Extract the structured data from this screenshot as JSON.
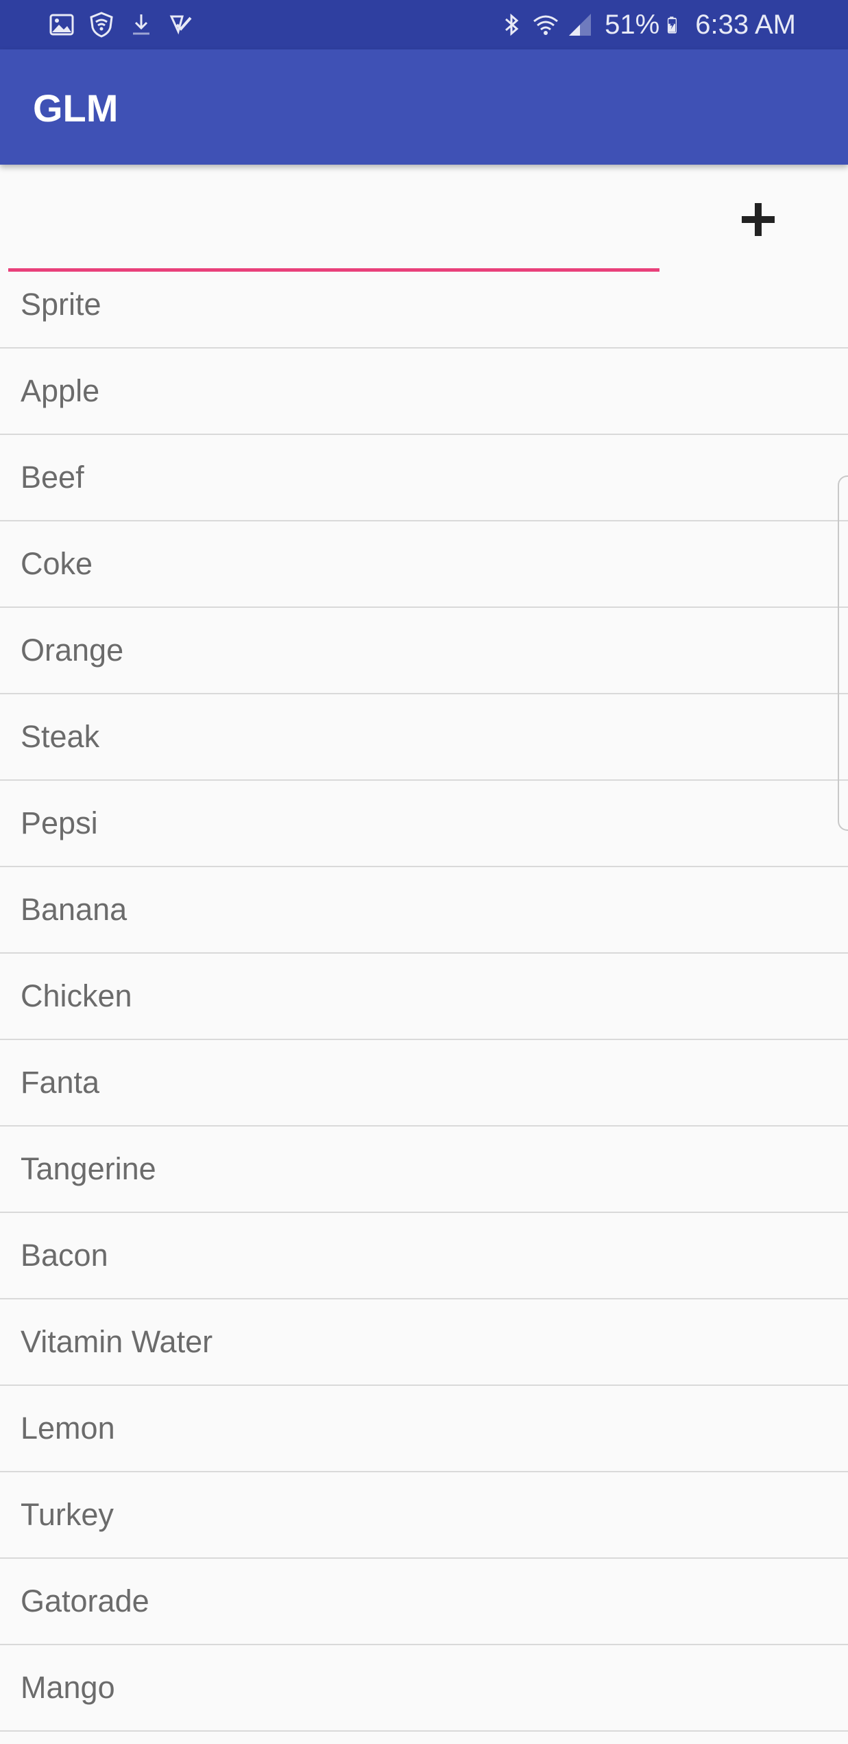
{
  "status_bar": {
    "left_icons": [
      "gallery-icon",
      "shield-wifi-icon",
      "download-icon",
      "task-check-icon"
    ],
    "right_icons": [
      "bluetooth-icon",
      "wifi-icon",
      "signal-icon",
      "battery-charging-icon"
    ],
    "battery_percent": "51%",
    "time": "6:33 AM",
    "colors": {
      "background": "#2f3fa0",
      "foreground": "#e8eaf6"
    }
  },
  "app_bar": {
    "title": "GLM",
    "color": "#3f51b5"
  },
  "input": {
    "value": "",
    "placeholder": "",
    "underline_color": "#e9407a"
  },
  "add_button": {
    "icon": "plus-icon"
  },
  "items": [
    {
      "label": "Sprite"
    },
    {
      "label": "Apple"
    },
    {
      "label": "Beef"
    },
    {
      "label": "Coke"
    },
    {
      "label": "Orange"
    },
    {
      "label": "Steak"
    },
    {
      "label": "Pepsi"
    },
    {
      "label": "Banana"
    },
    {
      "label": "Chicken"
    },
    {
      "label": "Fanta"
    },
    {
      "label": "Tangerine"
    },
    {
      "label": "Bacon"
    },
    {
      "label": "Vitamin Water"
    },
    {
      "label": "Lemon"
    },
    {
      "label": "Turkey"
    },
    {
      "label": "Gatorade"
    },
    {
      "label": "Mango"
    }
  ]
}
